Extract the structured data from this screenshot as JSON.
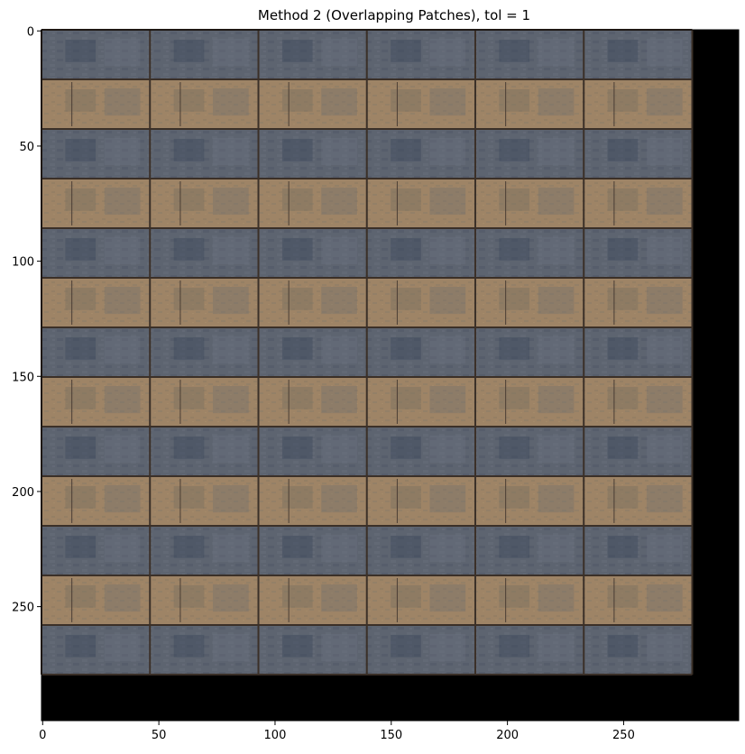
{
  "title": "Method 2 (Overlapping Patches), tol = 1",
  "image": {
    "width": 300,
    "height": 300,
    "content_width": 280,
    "content_height": 280,
    "background_color": "#000000",
    "row_pattern": [
      {
        "kind": "blue-gray-stone-band",
        "top_color": "#5e6470",
        "bottom_color": "#505c70"
      },
      {
        "kind": "tan-stone-band",
        "top_color": "#9e8466",
        "bottom_color": "#8d775e"
      }
    ],
    "mortar_color": "#3b3028",
    "tile_columns": 6
  },
  "axes": {
    "x_ticks": [
      "0",
      "50",
      "100",
      "150",
      "200",
      "250"
    ],
    "y_ticks": [
      "0",
      "50",
      "100",
      "150",
      "200",
      "250"
    ],
    "xlim": [
      -0.5,
      299.5
    ],
    "ylim": [
      299.5,
      -0.5
    ],
    "y_inverted": true
  }
}
